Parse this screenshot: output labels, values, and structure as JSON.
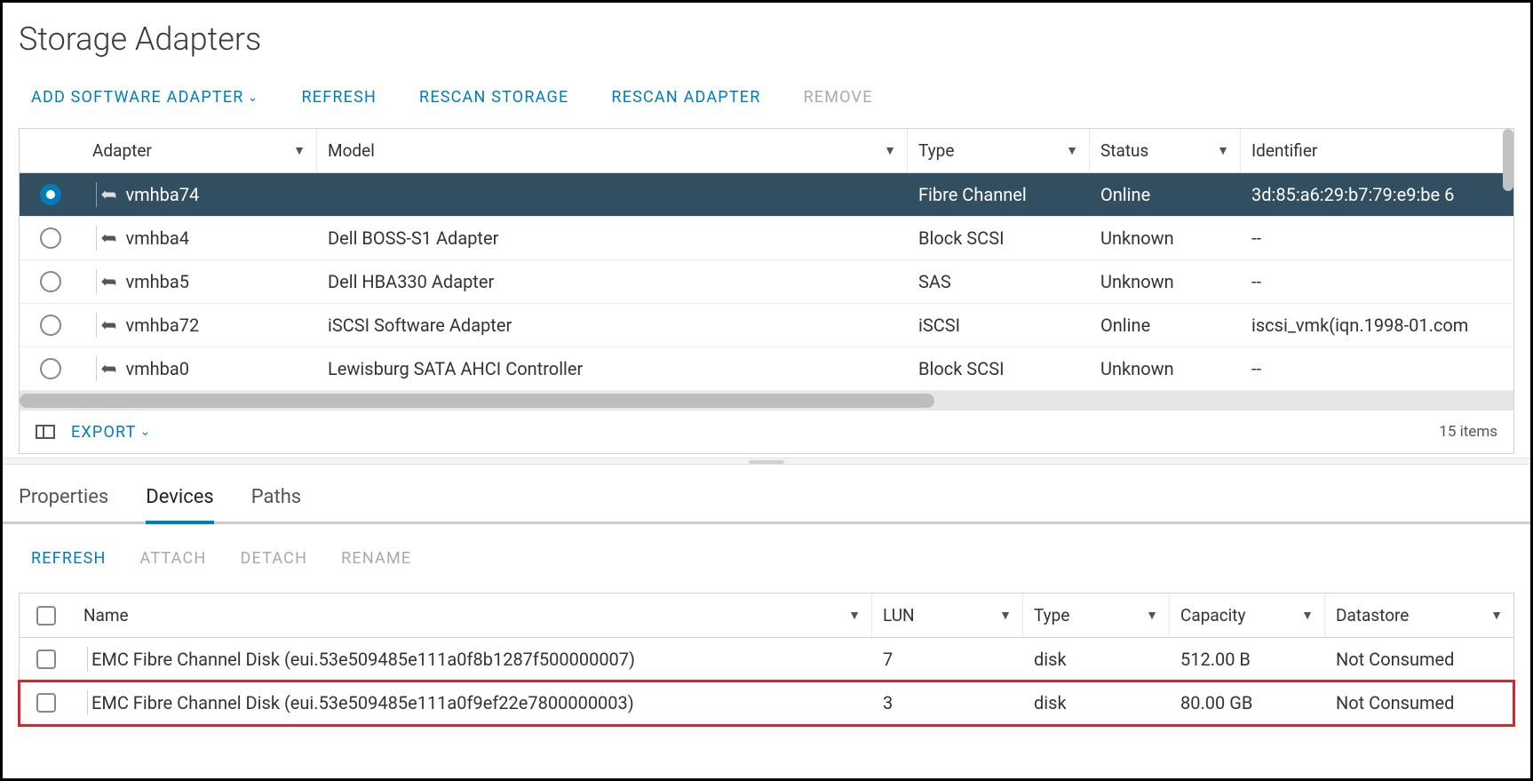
{
  "page": {
    "title": "Storage Adapters"
  },
  "toolbar": {
    "add_software_adapter": "ADD SOFTWARE ADAPTER",
    "refresh": "REFRESH",
    "rescan_storage": "RESCAN STORAGE",
    "rescan_adapter": "RESCAN ADAPTER",
    "remove": "REMOVE"
  },
  "adapters_table": {
    "headers": {
      "adapter": "Adapter",
      "model": "Model",
      "type": "Type",
      "status": "Status",
      "identifier": "Identifier"
    },
    "rows": [
      {
        "adapter": "vmhba74",
        "model": "",
        "type": "Fibre Channel",
        "status": "Online",
        "identifier": "3d:85:a6:29:b7:79:e9:be 6",
        "selected": true
      },
      {
        "adapter": "vmhba4",
        "model": "Dell BOSS-S1 Adapter",
        "type": "Block SCSI",
        "status": "Unknown",
        "identifier": "--",
        "selected": false
      },
      {
        "adapter": "vmhba5",
        "model": "Dell HBA330 Adapter",
        "type": "SAS",
        "status": "Unknown",
        "identifier": "--",
        "selected": false
      },
      {
        "adapter": "vmhba72",
        "model": "iSCSI Software Adapter",
        "type": "iSCSI",
        "status": "Online",
        "identifier": "iscsi_vmk(iqn.1998-01.com",
        "selected": false
      },
      {
        "adapter": "vmhba0",
        "model": "Lewisburg SATA AHCI Controller",
        "type": "Block SCSI",
        "status": "Unknown",
        "identifier": "--",
        "selected": false
      }
    ],
    "export_label": "EXPORT",
    "items_text": "15 items"
  },
  "tabs": {
    "properties": "Properties",
    "devices": "Devices",
    "paths": "Paths"
  },
  "devices_toolbar": {
    "refresh": "REFRESH",
    "attach": "ATTACH",
    "detach": "DETACH",
    "rename": "RENAME"
  },
  "devices_table": {
    "headers": {
      "name": "Name",
      "lun": "LUN",
      "type": "Type",
      "capacity": "Capacity",
      "datastore": "Datastore"
    },
    "rows": [
      {
        "name": "EMC Fibre Channel Disk (eui.53e509485e111a0f8b1287f500000007)",
        "lun": "7",
        "type": "disk",
        "capacity": "512.00 B",
        "datastore": "Not Consumed",
        "highlighted": false
      },
      {
        "name": "EMC Fibre Channel Disk (eui.53e509485e111a0f9ef22e7800000003)",
        "lun": "3",
        "type": "disk",
        "capacity": "80.00 GB",
        "datastore": "Not Consumed",
        "highlighted": true
      }
    ]
  }
}
